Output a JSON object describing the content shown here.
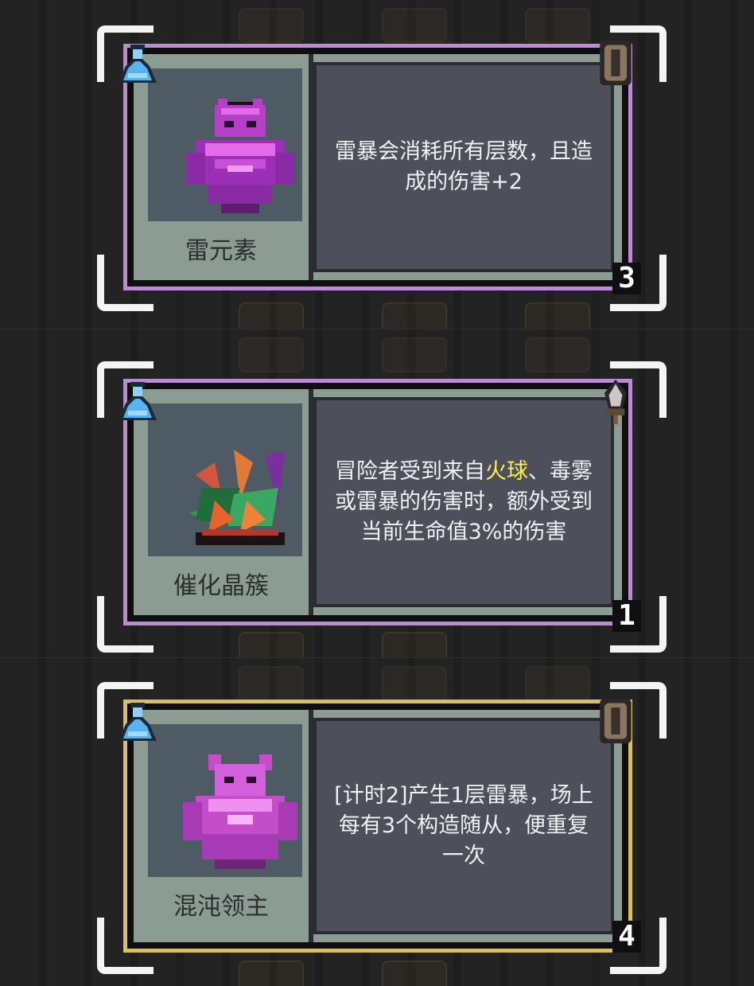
{
  "cards": [
    {
      "name": "雷元素",
      "description": [
        "雷暴会消耗所有层数，且造",
        "成的伤害+2"
      ],
      "count": "3",
      "frame_color": "#ba8cd1",
      "type_icon": "flask-icon",
      "tag_icon": "shield-icon",
      "portrait_icon": "thunder-elemental-icon"
    },
    {
      "name": "催化晶簇",
      "description_parts": {
        "a": "冒险者受到来自",
        "highlight": "火球",
        "b": "、毒雾",
        "line2": "或雷暴的伤害时，额外受到",
        "line3": "当前生命值3%的伤害"
      },
      "count": "1",
      "frame_color": "#ba8cd1",
      "highlight_color": "#f7f052",
      "type_icon": "flask-icon",
      "tag_icon": "sword-icon",
      "portrait_icon": "crystal-cluster-icon"
    },
    {
      "name": "混沌领主",
      "description": [
        "[计时2]产生1层雷暴，场上",
        "每有3个构造随从，便重复",
        "一次"
      ],
      "count": "4",
      "frame_color": "#d7bf62",
      "type_icon": "flask-icon",
      "tag_icon": "shield-icon",
      "portrait_icon": "chaos-lord-icon"
    }
  ]
}
